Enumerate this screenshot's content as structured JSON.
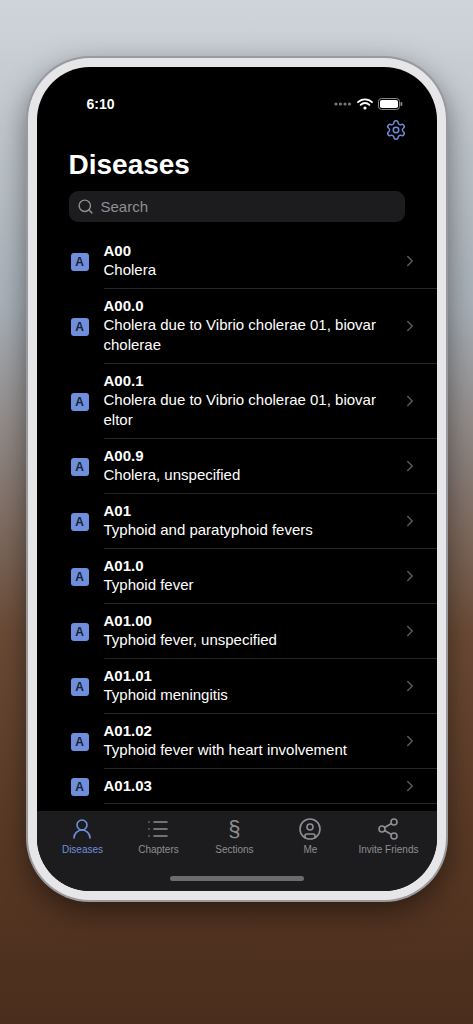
{
  "status_bar": {
    "time": "6:10"
  },
  "header": {
    "title": "Diseases"
  },
  "search": {
    "placeholder": "Search"
  },
  "rows": [
    {
      "badge": "A",
      "code": "A00",
      "name": "Cholera"
    },
    {
      "badge": "A",
      "code": "A00.0",
      "name": "Cholera due to Vibrio cholerae 01, biovar cholerae"
    },
    {
      "badge": "A",
      "code": "A00.1",
      "name": "Cholera due to Vibrio cholerae 01, biovar eltor"
    },
    {
      "badge": "A",
      "code": "A00.9",
      "name": "Cholera, unspecified"
    },
    {
      "badge": "A",
      "code": "A01",
      "name": "Typhoid and paratyphoid fevers"
    },
    {
      "badge": "A",
      "code": "A01.0",
      "name": "Typhoid fever"
    },
    {
      "badge": "A",
      "code": "A01.00",
      "name": "Typhoid fever, unspecified"
    },
    {
      "badge": "A",
      "code": "A01.01",
      "name": "Typhoid meningitis"
    },
    {
      "badge": "A",
      "code": "A01.02",
      "name": "Typhoid fever with heart involvement"
    },
    {
      "badge": "A",
      "code": "A01.03",
      "name": ""
    }
  ],
  "tabs": [
    {
      "label": "Diseases",
      "selected": true,
      "glyph": ""
    },
    {
      "label": "Chapters",
      "selected": false,
      "glyph": ""
    },
    {
      "label": "Sections",
      "selected": false,
      "glyph": "§"
    },
    {
      "label": "Me",
      "selected": false,
      "glyph": ""
    },
    {
      "label": "Invite Friends",
      "selected": false,
      "glyph": ""
    }
  ]
}
